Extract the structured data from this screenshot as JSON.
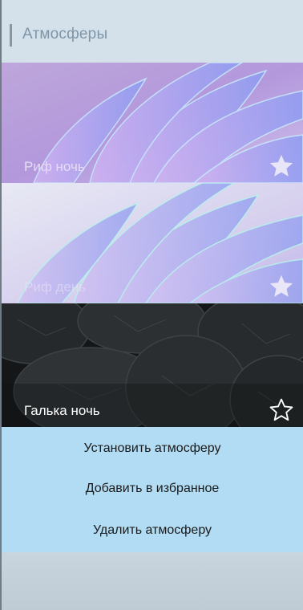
{
  "header": {
    "title": "Атмосферы"
  },
  "tiles": [
    {
      "label": "Риф ночь",
      "favorite": true,
      "label_color": "#e6dcf5"
    },
    {
      "label": "Риф день",
      "favorite": true,
      "label_color": "#e8e2f4"
    },
    {
      "label": "Галька ночь",
      "favorite": false,
      "label_color": "#ffffff"
    }
  ],
  "menu": {
    "items": [
      {
        "label": "Установить атмосферу"
      },
      {
        "label": "Добавить в избранное"
      },
      {
        "label": "Удалить атмосферу"
      }
    ]
  },
  "colors": {
    "menu_background": "#b2dcf3",
    "header_text": "#7f96a8"
  },
  "icons": {
    "favorite_filled": "star-filled-icon",
    "favorite_outline": "star-outline-icon"
  }
}
